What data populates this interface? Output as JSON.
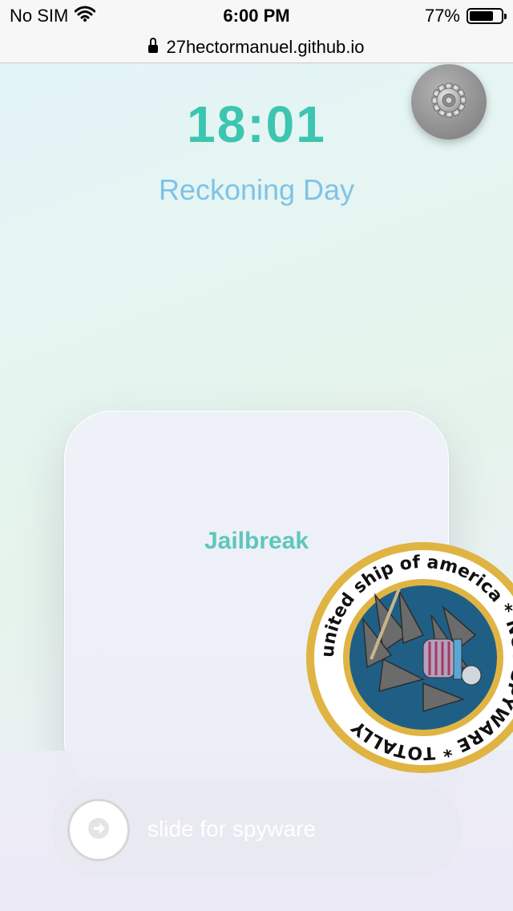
{
  "status_bar": {
    "carrier": "No SIM",
    "time": "6:00 PM",
    "battery_percent": "77%",
    "battery_level": 0.77,
    "wifi_icon": "wifi-icon"
  },
  "browser": {
    "url": "27hectormanuel.github.io",
    "lock_icon": "lock-icon"
  },
  "main": {
    "clock": "18:01",
    "subtitle": "Reckoning Day",
    "settings_icon": "gear-icon"
  },
  "card": {
    "label": "Jailbreak"
  },
  "slider": {
    "label": "slide for spyware",
    "knob_icon": "arrow-right-icon"
  },
  "seal": {
    "ring_text": "united ship of america * NOT SPYWARE * TOTALLY"
  },
  "colors": {
    "clock": "#3cc5b0",
    "subtitle": "#7ec3e8",
    "card_label": "#5ec6bd",
    "seal_gold": "#e0b443",
    "seal_blue": "#1f5f86"
  }
}
